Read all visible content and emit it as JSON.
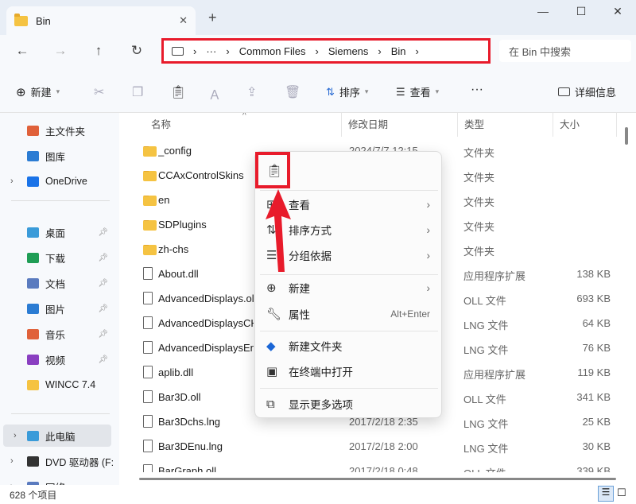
{
  "window": {
    "tab_title": "Bin",
    "new_tab": "+",
    "minimize": "—",
    "maximize": "☐",
    "close": "✕"
  },
  "nav": {
    "back": "←",
    "forward": "→",
    "up": "↑",
    "refresh": "↻"
  },
  "address": {
    "more": "···",
    "crumbs": [
      "Common Files",
      "Siemens",
      "Bin"
    ],
    "search_placeholder": "在 Bin 中搜索"
  },
  "toolbar": {
    "new": "新建",
    "sort": "排序",
    "view": "查看",
    "more": "···",
    "details": "详细信息"
  },
  "sidebar": {
    "items": [
      {
        "label": "主文件夹",
        "color": "#e0613a"
      },
      {
        "label": "图库",
        "color": "#2b7cd3"
      },
      {
        "label": "OneDrive",
        "color": "#1a73e8",
        "expand": true
      },
      {
        "label": "桌面",
        "color": "#3a9bd9",
        "pinned": true
      },
      {
        "label": "下载",
        "color": "#1f9d55",
        "pinned": true
      },
      {
        "label": "文档",
        "color": "#5a7bbf",
        "pinned": true
      },
      {
        "label": "图片",
        "color": "#2b7cd3",
        "pinned": true
      },
      {
        "label": "音乐",
        "color": "#e0613a",
        "pinned": true
      },
      {
        "label": "视频",
        "color": "#8a3fc1",
        "pinned": true
      },
      {
        "label": "WINCC 7.4",
        "color": "#f5c342"
      },
      {
        "label": "此电脑",
        "color": "#3a9bd9",
        "expand": true,
        "selected": true
      },
      {
        "label": "DVD 驱动器 (F:",
        "color": "#333",
        "expand": true
      },
      {
        "label": "网络",
        "color": "#5a7bbf",
        "expand": true
      }
    ]
  },
  "columns": {
    "name": "名称",
    "date": "修改日期",
    "type": "类型",
    "size": "大小"
  },
  "files": [
    {
      "name": "_config",
      "date": "2024/7/7 12:15",
      "type": "文件夹",
      "size": "",
      "kind": "folder"
    },
    {
      "name": "CCAxControlSkins",
      "date": "",
      "type": "文件夹",
      "size": "",
      "kind": "folder"
    },
    {
      "name": "en",
      "date": "",
      "type": "文件夹",
      "size": "",
      "kind": "folder"
    },
    {
      "name": "SDPlugins",
      "date": "",
      "type": "文件夹",
      "size": "",
      "kind": "folder"
    },
    {
      "name": "zh-chs",
      "date": "",
      "type": "文件夹",
      "size": "",
      "kind": "folder"
    },
    {
      "name": "About.dll",
      "date": "",
      "type": "应用程序扩展",
      "size": "138 KB",
      "kind": "file"
    },
    {
      "name": "AdvancedDisplays.oll",
      "date": "",
      "type": "OLL 文件",
      "size": "693 KB",
      "kind": "file"
    },
    {
      "name": "AdvancedDisplaysCH",
      "date": "",
      "type": "LNG 文件",
      "size": "64 KB",
      "kind": "file"
    },
    {
      "name": "AdvancedDisplaysEn",
      "date": "",
      "type": "LNG 文件",
      "size": "76 KB",
      "kind": "file"
    },
    {
      "name": "aplib.dll",
      "date": "",
      "type": "应用程序扩展",
      "size": "119 KB",
      "kind": "file"
    },
    {
      "name": "Bar3D.oll",
      "date": "",
      "type": "OLL 文件",
      "size": "341 KB",
      "kind": "file"
    },
    {
      "name": "Bar3Dchs.lng",
      "date": "2017/2/18 2:35",
      "type": "LNG 文件",
      "size": "25 KB",
      "kind": "file"
    },
    {
      "name": "Bar3DEnu.lng",
      "date": "2017/2/18 2:00",
      "type": "LNG 文件",
      "size": "30 KB",
      "kind": "file"
    },
    {
      "name": "BarGraph.oll",
      "date": "2017/2/18 0:48",
      "type": "OLL 文件",
      "size": "339 KB",
      "kind": "file"
    }
  ],
  "context_menu": {
    "items": [
      {
        "label": "查看",
        "icon": "view-icon",
        "arrow": true
      },
      {
        "label": "排序方式",
        "icon": "sort-icon",
        "arrow": true
      },
      {
        "label": "分组依据",
        "icon": "group-icon",
        "arrow": true
      },
      {
        "label": "新建",
        "icon": "plus-circle-icon",
        "arrow": true
      },
      {
        "label": "属性",
        "icon": "wrench-icon",
        "shortcut": "Alt+Enter"
      },
      {
        "label": "新建文件夹",
        "icon": "new-folder-icon"
      },
      {
        "label": "在终端中打开",
        "icon": "terminal-icon"
      },
      {
        "label": "显示更多选项",
        "icon": "more-options-icon"
      }
    ]
  },
  "status": {
    "count": "628 个项目"
  },
  "annotation_color": "#e81b2b"
}
